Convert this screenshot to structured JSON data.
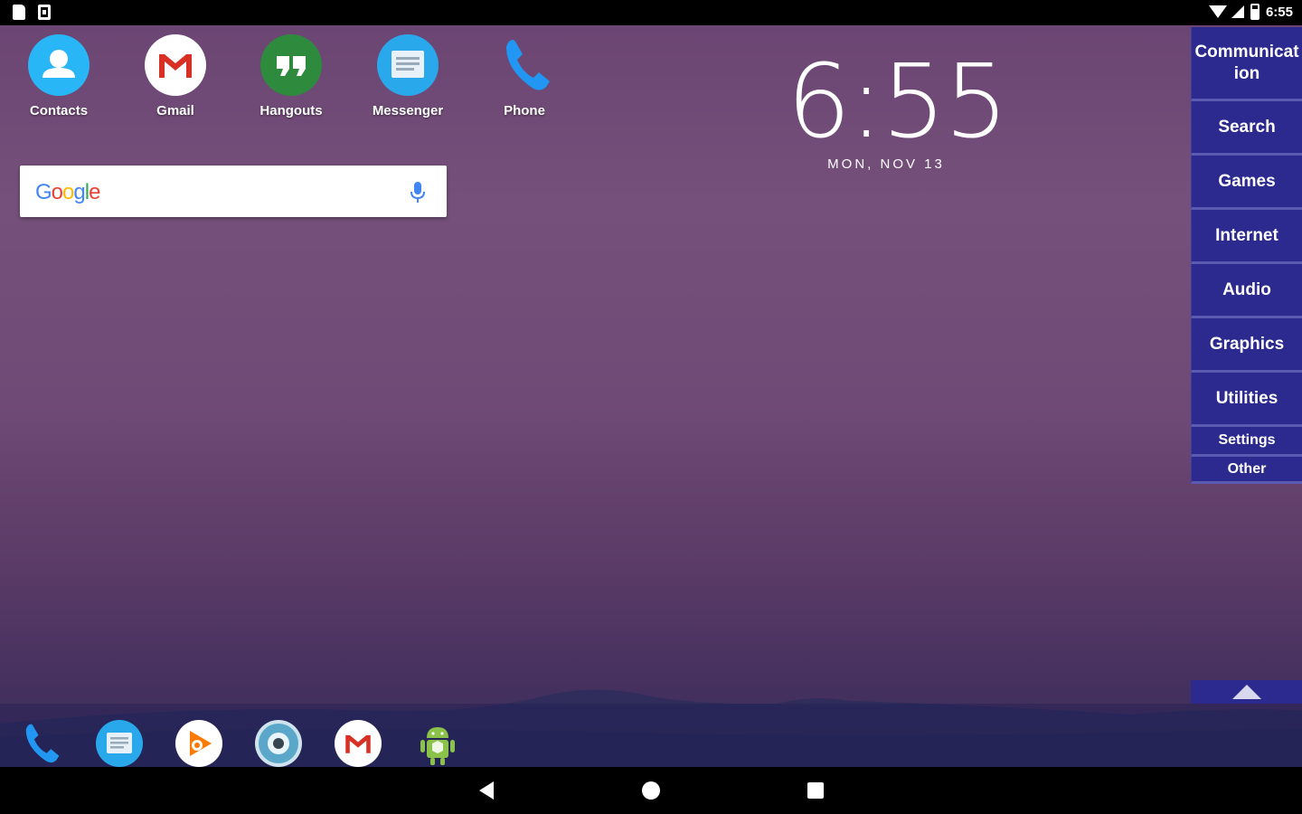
{
  "status_bar": {
    "left_icons": [
      "sd-card-icon",
      "notification-box-icon"
    ],
    "right_icons": [
      "wifi-icon",
      "cell-signal-icon",
      "battery-icon"
    ],
    "time": "6:55"
  },
  "home_apps": [
    {
      "label": "Contacts",
      "icon": "contacts-icon",
      "color": "#29b6f6"
    },
    {
      "label": "Gmail",
      "icon": "gmail-icon",
      "color": "#ffffff"
    },
    {
      "label": "Hangouts",
      "icon": "hangouts-icon",
      "color": "#2e8b3e"
    },
    {
      "label": "Messenger",
      "icon": "messenger-icon",
      "color": "#29a8ec"
    },
    {
      "label": "Phone",
      "icon": "phone-icon",
      "color": "#2196f3"
    }
  ],
  "search": {
    "logo": "Google",
    "mic_icon": "mic-icon"
  },
  "clock": {
    "time": "6:55",
    "date": "MON, NOV 13"
  },
  "side_menu": {
    "items": [
      "Communicat ion",
      "Search",
      "Games",
      "Internet",
      "Audio",
      "Graphics",
      "Utilities",
      "Settings",
      "Other"
    ],
    "expand_icon": "triangle-up-icon",
    "color": "#2c2a8e"
  },
  "dock": {
    "icons": [
      "phone-icon",
      "messenger-icon",
      "play-music-icon",
      "camera-icon",
      "gmail-icon",
      "android-robot-icon"
    ]
  },
  "nav_bar": {
    "icons": [
      "back-icon",
      "home-icon",
      "recents-icon"
    ]
  }
}
